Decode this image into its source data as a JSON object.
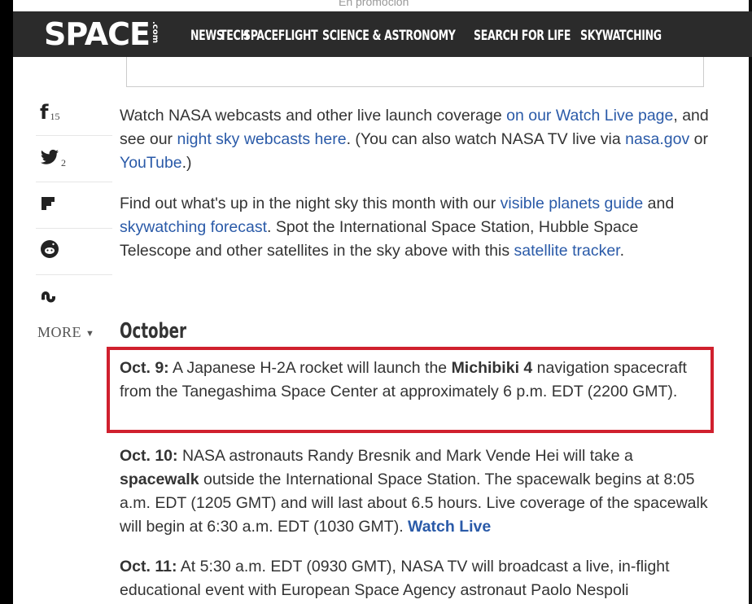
{
  "header": {
    "logo_main": "SPACE",
    "logo_suffix": ".com",
    "nav": [
      "NEWS",
      "TECH",
      "SPACEFLIGHT",
      "SCIENCE & ASTRONOMY",
      "SEARCH FOR LIFE",
      "SKYWATCHING"
    ]
  },
  "promo_ghost": "En promoción",
  "share": {
    "facebook_count": "15",
    "twitter_count": "2",
    "more_label": "MORE"
  },
  "intro": {
    "p1": [
      {
        "t": "Watch NASA webcasts and other live launch coverage "
      },
      {
        "t": "on our Watch Live page",
        "link": true
      },
      {
        "t": ", and see our "
      },
      {
        "t": "night sky webcasts here",
        "link": true
      },
      {
        "t": ". (You can also watch NASA TV live via "
      },
      {
        "t": "nasa.gov",
        "link": true
      },
      {
        "t": " or "
      },
      {
        "t": "YouTube",
        "link": true
      },
      {
        "t": ".)"
      }
    ],
    "p2": [
      {
        "t": "Find out what's up in the night sky this month with our "
      },
      {
        "t": "visible planets guide",
        "link": true
      },
      {
        "t": " and "
      },
      {
        "t": "skywatching forecast",
        "link": true
      },
      {
        "t": ". Spot the International Space Station, Hubble Space Telescope and other satellites in the sky above with this "
      },
      {
        "t": "satellite tracker",
        "link": true
      },
      {
        "t": "."
      }
    ]
  },
  "month_heading": "October",
  "events": [
    {
      "date": "Oct. 9:",
      "parts": [
        {
          "t": " A Japanese H-2A rocket will launch the "
        },
        {
          "t": "Michibiki 4",
          "bold": true
        },
        {
          "t": " navigation spacecraft from the Tanegashima Space Center at approximately 6 p.m. EDT (2200 GMT)."
        }
      ]
    },
    {
      "date": "Oct. 10:",
      "parts": [
        {
          "t": " NASA astronauts Randy Bresnik and Mark Vende Hei will take a "
        },
        {
          "t": "spacewalk",
          "bold": true
        },
        {
          "t": " outside the International Space Station. The spacewalk begins at 8:05 a.m. EDT (1205 GMT) and will last about 6.5 hours. Live coverage of the spacewalk will begin at 6:30 a.m. EDT (1030 GMT). "
        },
        {
          "t": "Watch Live",
          "watch": true
        }
      ]
    },
    {
      "date": "Oct. 11:",
      "parts": [
        {
          "t": " At 5:30 a.m. EDT (0930 GMT), NASA TV will broadcast a live, in-flight educational event with European Space Agency astronaut Paolo Nespoli"
        }
      ]
    }
  ]
}
